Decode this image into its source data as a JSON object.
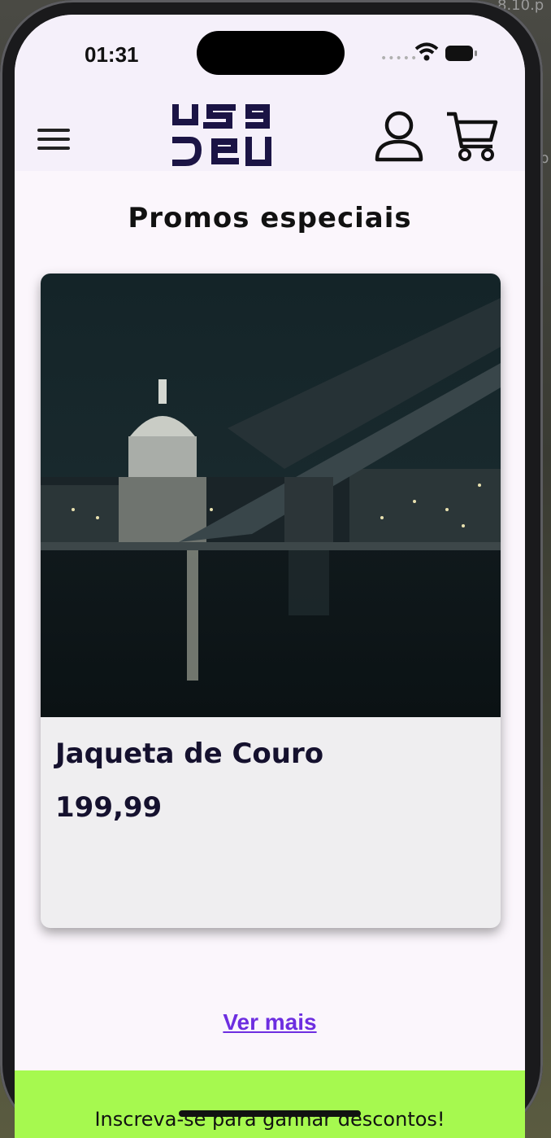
{
  "status_bar": {
    "time": "01:31",
    "signal_icon": "signal-dots-icon",
    "wifi_icon": "wifi-icon",
    "battery_icon": "battery-icon"
  },
  "header": {
    "logo_text": "use DeU",
    "menu_icon": "hamburger-menu-icon",
    "user_icon": "user-icon",
    "cart_icon": "cart-icon"
  },
  "section_title": "Promos especiais",
  "product": {
    "name": "Jaqueta de Couro",
    "price": "199,99"
  },
  "see_more_label": "Ver mais",
  "footer": {
    "text": "Inscreva-se para ganhar descontos!",
    "color": "#a6f94f"
  },
  "colors": {
    "accent": "#6d2ee0",
    "brand_dark": "#15112e",
    "background": "#fbf6fc"
  }
}
